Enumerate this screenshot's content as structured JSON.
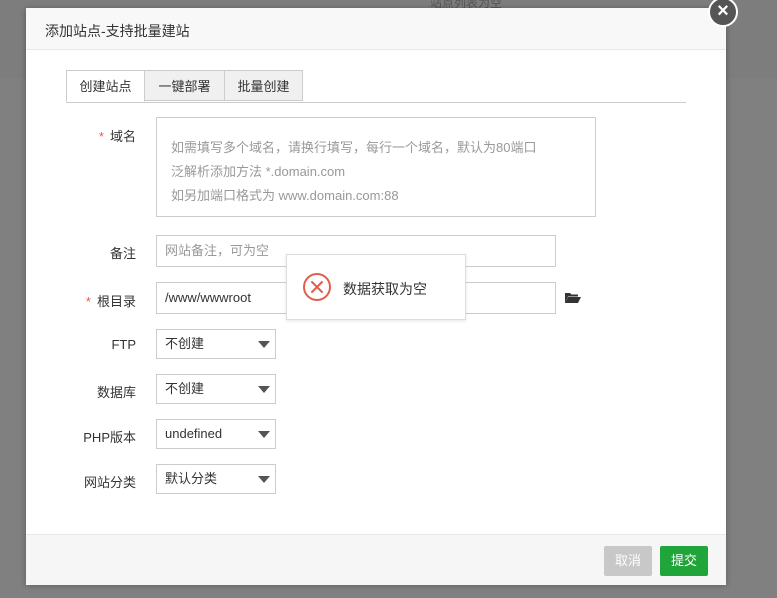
{
  "background": {
    "text": "站点列表为空"
  },
  "dialog": {
    "title": "添加站点-支持批量建站",
    "close_label": "×"
  },
  "tabs": [
    {
      "label": "创建站点",
      "active": true
    },
    {
      "label": "一键部署",
      "active": false
    },
    {
      "label": "批量创建",
      "active": false
    }
  ],
  "form": {
    "required_mark": "*",
    "domain": {
      "label": "域名",
      "placeholder_lines": [
        "如需填写多个域名，请换行填写，每行一个域名，默认为80端口",
        "泛解析添加方法 *.domain.com",
        "如另加端口格式为 www.domain.com:88"
      ]
    },
    "remark": {
      "label": "备注",
      "placeholder": "网站备注，可为空"
    },
    "root": {
      "label": "根目录",
      "value": "/www/wwwroot"
    },
    "ftp": {
      "label": "FTP",
      "value": "不创建"
    },
    "database": {
      "label": "数据库",
      "value": "不创建"
    },
    "php": {
      "label": "PHP版本",
      "value": "undefined"
    },
    "category": {
      "label": "网站分类",
      "value": "默认分类"
    }
  },
  "toast": {
    "message": "数据获取为空",
    "icon": "error-circle-icon",
    "color": "#e35d4c"
  },
  "footer": {
    "cancel_label": "取消",
    "submit_label": "提交"
  },
  "colors": {
    "submit": "#20a53a",
    "cancel": "#c8c8c8",
    "required": "#e35d4c"
  }
}
